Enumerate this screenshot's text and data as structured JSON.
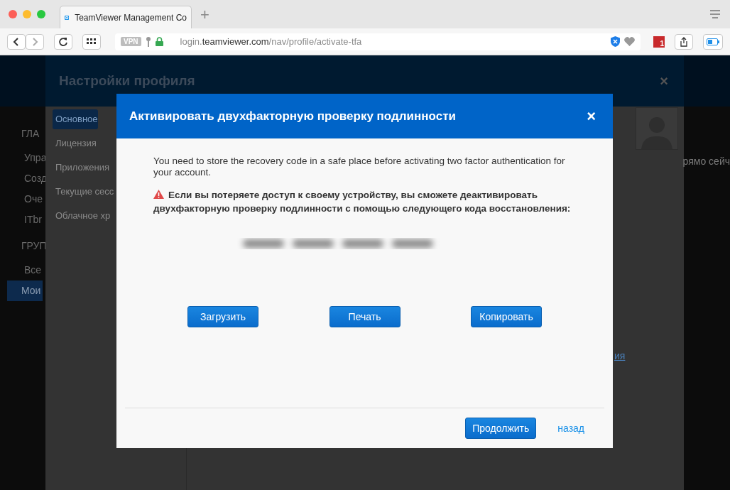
{
  "browser": {
    "tab_title": "TeamViewer Management Co",
    "new_tab": "+",
    "vpn": "VPN",
    "url": {
      "subdomain": "login.",
      "domain": "teamviewer.com",
      "path": "/nav/profile/activate-tfa"
    },
    "badge_count": "1"
  },
  "app_sidebar": {
    "items": [
      {
        "label": "ГЛА",
        "kind": "heading",
        "selected": false
      },
      {
        "label": "Упра",
        "kind": "item",
        "selected": false
      },
      {
        "label": "Созд",
        "kind": "item",
        "selected": false
      },
      {
        "label": "Оче",
        "kind": "item",
        "selected": false
      },
      {
        "label": "ITbr",
        "kind": "item",
        "selected": false
      },
      {
        "label": "ГРУП",
        "kind": "heading",
        "selected": false
      },
      {
        "label": "Все",
        "kind": "item",
        "selected": false
      },
      {
        "label": "Мои",
        "kind": "item",
        "selected": true
      }
    ]
  },
  "app_right": {
    "fragment": "рямо сейч",
    "link": "ия"
  },
  "panel": {
    "title": "Настройки профиля",
    "close": "×",
    "nav": [
      {
        "label": "Основное",
        "selected": true
      },
      {
        "label": "Лицензия",
        "selected": false
      },
      {
        "label": "Приложения",
        "selected": false
      },
      {
        "label": "Текущие сесс",
        "selected": false
      },
      {
        "label": "Облачное хр",
        "selected": false
      }
    ]
  },
  "dialog": {
    "title": "Активировать двухфакторную проверку подлинности",
    "close": "×",
    "intro": "You need to store the recovery code in a safe place before activating two factor authentication for your account.",
    "warning": "Если вы потеряете доступ к своему устройству, вы сможете деактивировать двухфакторную проверку подлинности с помощью следующего кода восстановления:",
    "actions": [
      "Загрузить",
      "Печать",
      "Копировать"
    ],
    "primary": "Продолжить",
    "back": "назад"
  }
}
